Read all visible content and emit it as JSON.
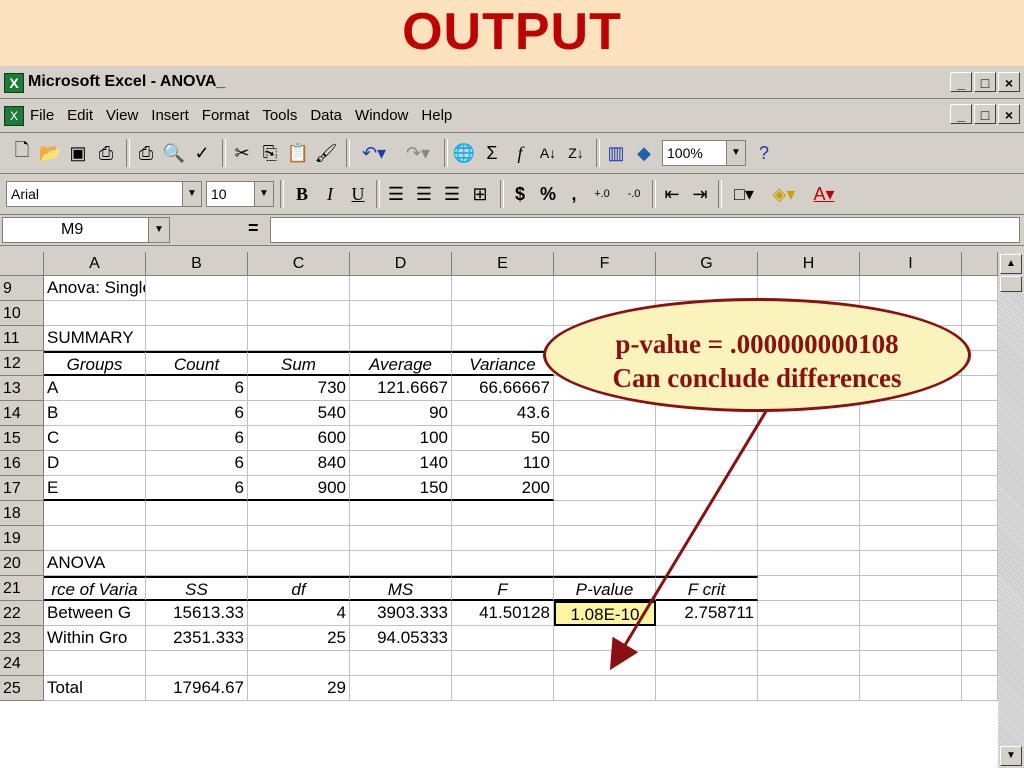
{
  "slide_title": "OUTPUT",
  "window": {
    "title": "Microsoft Excel - ANOVA_",
    "min": "_",
    "max": "□",
    "close": "×"
  },
  "menu": [
    "File",
    "Edit",
    "View",
    "Insert",
    "Format",
    "Tools",
    "Data",
    "Window",
    "Help"
  ],
  "toolbar": {
    "zoom": "100%",
    "font": "Arial",
    "size": "10"
  },
  "formula_bar": {
    "name_box": "M9",
    "equals": "="
  },
  "columns": [
    "A",
    "B",
    "C",
    "D",
    "E",
    "F",
    "G",
    "H",
    "I"
  ],
  "rows": [
    {
      "n": "9",
      "cells": [
        "Anova: Single Factor",
        "",
        "",
        "",
        "",
        "",
        "",
        "",
        ""
      ]
    },
    {
      "n": "10",
      "cells": [
        "",
        "",
        "",
        "",
        "",
        "",
        "",
        "",
        ""
      ]
    },
    {
      "n": "11",
      "cells": [
        "SUMMARY",
        "",
        "",
        "",
        "",
        "",
        "",
        "",
        ""
      ]
    },
    {
      "n": "12",
      "cells": [
        "Groups",
        "Count",
        "Sum",
        "Average",
        "Variance",
        "",
        "",
        "",
        ""
      ]
    },
    {
      "n": "13",
      "cells": [
        "A",
        "6",
        "730",
        "121.6667",
        "66.66667",
        "",
        "",
        "",
        ""
      ]
    },
    {
      "n": "14",
      "cells": [
        "B",
        "6",
        "540",
        "90",
        "43.6",
        "",
        "",
        "",
        ""
      ]
    },
    {
      "n": "15",
      "cells": [
        "C",
        "6",
        "600",
        "100",
        "50",
        "",
        "",
        "",
        ""
      ]
    },
    {
      "n": "16",
      "cells": [
        "D",
        "6",
        "840",
        "140",
        "110",
        "",
        "",
        "",
        ""
      ]
    },
    {
      "n": "17",
      "cells": [
        "E",
        "6",
        "900",
        "150",
        "200",
        "",
        "",
        "",
        ""
      ]
    },
    {
      "n": "18",
      "cells": [
        "",
        "",
        "",
        "",
        "",
        "",
        "",
        "",
        ""
      ]
    },
    {
      "n": "19",
      "cells": [
        "",
        "",
        "",
        "",
        "",
        "",
        "",
        "",
        ""
      ]
    },
    {
      "n": "20",
      "cells": [
        "ANOVA",
        "",
        "",
        "",
        "",
        "",
        "",
        "",
        ""
      ]
    },
    {
      "n": "21",
      "cells": [
        "rce of Varia",
        "SS",
        "df",
        "MS",
        "F",
        "P-value",
        "F crit",
        "",
        ""
      ]
    },
    {
      "n": "22",
      "cells": [
        "Between G",
        "15613.33",
        "4",
        "3903.333",
        "41.50128",
        "1.08E-10",
        "2.758711",
        "",
        ""
      ]
    },
    {
      "n": "23",
      "cells": [
        "Within Gro",
        "2351.333",
        "25",
        "94.05333",
        "",
        "",
        "",
        "",
        ""
      ]
    },
    {
      "n": "24",
      "cells": [
        "",
        "",
        "",
        "",
        "",
        "",
        "",
        "",
        ""
      ]
    },
    {
      "n": "25",
      "cells": [
        "Total",
        "17964.67",
        "29",
        "",
        "",
        "",
        "",
        "",
        ""
      ]
    }
  ],
  "callout": {
    "line1": "p-value = .000000000108",
    "line2": "Can conclude differences"
  },
  "colors": {
    "title": "#c00000",
    "callout_border": "#8b1010",
    "callout_bg": "#fbf3bc",
    "selected_cell": "#fff4a0"
  }
}
